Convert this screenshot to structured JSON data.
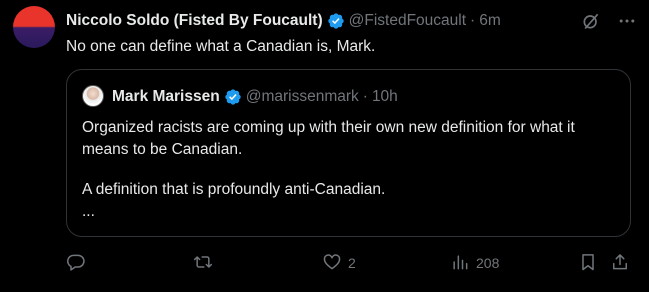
{
  "tweet": {
    "author_name": "Niccolo Soldo (Fisted By Foucault)",
    "handle": "@FistedFoucault",
    "separator": "·",
    "time": "6m",
    "text": "No one can define what a Canadian is, Mark."
  },
  "quote": {
    "author_name": "Mark Marissen",
    "handle": "@marissenmark",
    "separator": "·",
    "time": "10h",
    "paragraph1": "Organized racists are coming up with their own new definition for what it means to be Canadian.",
    "paragraph2": "A definition that is profoundly anti-Canadian.",
    "ellipsis": "..."
  },
  "actions": {
    "like_count": "2",
    "views_count": "208"
  },
  "icons": {
    "verified": "verified-badge-icon",
    "grok": "grok-icon",
    "more": "more-options-icon",
    "reply": "reply-icon",
    "retweet": "retweet-icon",
    "like": "heart-icon",
    "views": "analytics-icon",
    "bookmark": "bookmark-icon",
    "share": "share-icon"
  },
  "colors": {
    "background": "#000000",
    "text": "#e7e9ea",
    "muted": "#71767b",
    "verified": "#1d9bf0",
    "border": "#2f3336"
  }
}
